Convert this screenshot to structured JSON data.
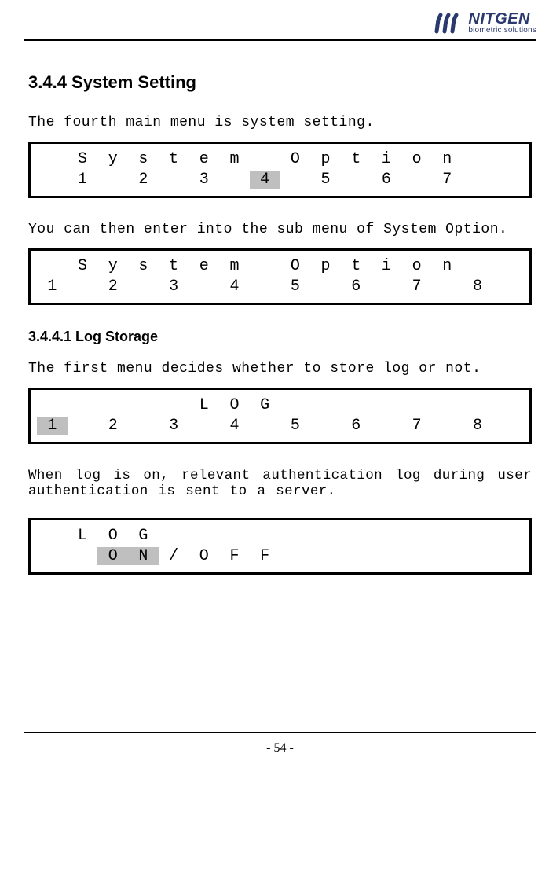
{
  "brand": {
    "name": "NITGEN",
    "tagline": "biometric solutions"
  },
  "section_heading": "3.4.4 System Setting",
  "para1": "The fourth main menu is system setting.",
  "lcd1": {
    "row1": [
      " ",
      "S",
      "y",
      "s",
      "t",
      "e",
      "m",
      " ",
      "O",
      "p",
      "t",
      "i",
      "o",
      "n",
      " ",
      " "
    ],
    "row2": [
      " ",
      "1",
      " ",
      "2",
      " ",
      "3",
      " ",
      "4",
      " ",
      "5",
      " ",
      "6",
      " ",
      "7",
      " ",
      " "
    ],
    "highlight2": [
      7
    ]
  },
  "para2": "You can then enter into the sub menu of System Option.",
  "lcd2": {
    "row1": [
      " ",
      "S",
      "y",
      "s",
      "t",
      "e",
      "m",
      " ",
      "O",
      "p",
      "t",
      "i",
      "o",
      "n",
      " ",
      " "
    ],
    "row2": [
      "1",
      " ",
      "2",
      " ",
      "3",
      " ",
      "4",
      " ",
      "5",
      " ",
      "6",
      " ",
      "7",
      " ",
      "8",
      " "
    ]
  },
  "subsection_heading": "3.4.4.1 Log Storage",
  "para3": "The first menu decides whether to store log or not.",
  "lcd3": {
    "row1": [
      " ",
      " ",
      " ",
      " ",
      " ",
      "L",
      "O",
      "G",
      " ",
      " ",
      " ",
      " ",
      " ",
      " ",
      " ",
      " "
    ],
    "row2": [
      "1",
      " ",
      "2",
      " ",
      "3",
      " ",
      "4",
      " ",
      "5",
      " ",
      "6",
      " ",
      "7",
      " ",
      "8",
      " "
    ],
    "highlight2": [
      0
    ]
  },
  "para4": "When log is on, relevant authentication log during user authentication is sent to a server.",
  "lcd4": {
    "row1": [
      " ",
      "L",
      "O",
      "G",
      " ",
      " ",
      " ",
      " ",
      " ",
      " ",
      " ",
      " ",
      " ",
      " ",
      " ",
      " "
    ],
    "row2": [
      " ",
      " ",
      "O",
      "N",
      "/",
      "O",
      "F",
      "F",
      " ",
      " ",
      " ",
      " ",
      " ",
      " ",
      " ",
      " "
    ],
    "highlight2": [
      2,
      3
    ]
  },
  "page_number": "- 54 -"
}
